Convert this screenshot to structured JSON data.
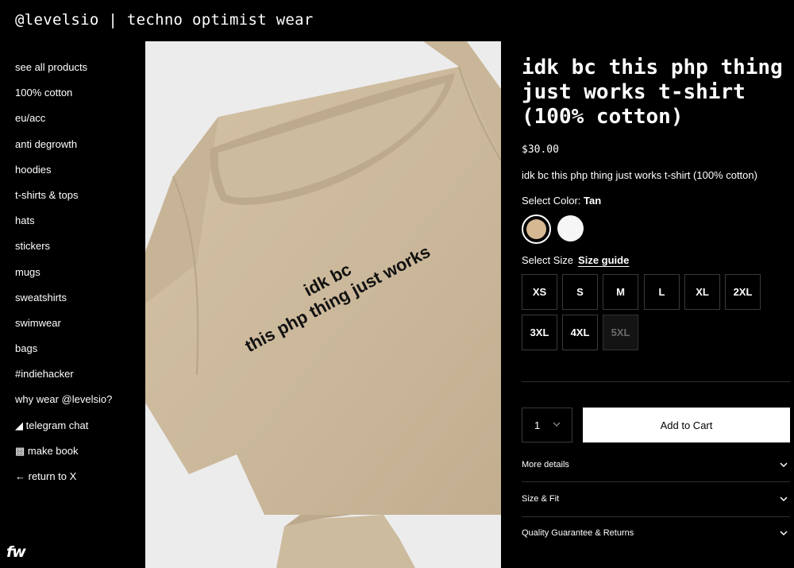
{
  "brand": {
    "title": "@levelsio | techno optimist wear"
  },
  "sidebar": {
    "items": [
      {
        "label": "see all products"
      },
      {
        "label": "100% cotton"
      },
      {
        "label": "eu/acc"
      },
      {
        "label": "anti degrowth"
      },
      {
        "label": "hoodies"
      },
      {
        "label": "t-shirts & tops"
      },
      {
        "label": "hats"
      },
      {
        "label": "stickers"
      },
      {
        "label": "mugs"
      },
      {
        "label": "sweatshirts"
      },
      {
        "label": "swimwear"
      },
      {
        "label": "bags"
      },
      {
        "label": "#indiehacker"
      },
      {
        "label": "why wear @levelsio?"
      },
      {
        "label": "◢ telegram chat"
      },
      {
        "label": "▩ make book"
      },
      {
        "label": "← return to X"
      }
    ]
  },
  "footer_logo": "fw",
  "product_image": {
    "print_line1": "idk bc",
    "print_line2": "this php thing just works"
  },
  "product": {
    "title": "idk bc this php thing just works t-shirt (100% cotton)",
    "price": "$30.00",
    "description": "idk bc this php thing just works t-shirt (100% cotton)",
    "color_label": "Select Color:",
    "selected_color": "Tan",
    "colors": [
      {
        "name": "Tan",
        "hex": "#d6b893",
        "selected": true
      },
      {
        "name": "White",
        "hex": "#f6f6f6",
        "selected": false
      }
    ],
    "size_label": "Select Size",
    "size_guide": "Size guide",
    "sizes": [
      {
        "label": "XS",
        "available": true
      },
      {
        "label": "S",
        "available": true
      },
      {
        "label": "M",
        "available": true
      },
      {
        "label": "L",
        "available": true
      },
      {
        "label": "XL",
        "available": true
      },
      {
        "label": "2XL",
        "available": true
      },
      {
        "label": "3XL",
        "available": true
      },
      {
        "label": "4XL",
        "available": true
      },
      {
        "label": "5XL",
        "available": false
      }
    ],
    "quantity": "1",
    "add_to_cart": "Add to Cart",
    "accordions": [
      {
        "label": "More details"
      },
      {
        "label": "Size & Fit"
      },
      {
        "label": "Quality Guarantee & Returns"
      }
    ]
  }
}
